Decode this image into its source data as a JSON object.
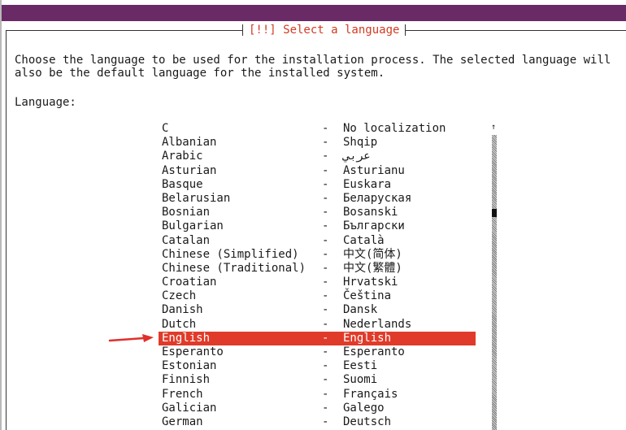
{
  "dialog": {
    "title": "[!!] Select a language",
    "intro_line1": "Choose the language to be used for the installation process. The selected language will",
    "intro_line2": "also be the default language for the installed system.",
    "list_label": "Language:"
  },
  "languages": [
    {
      "name": "C",
      "dash": "-",
      "native": "No localization"
    },
    {
      "name": "Albanian",
      "dash": "-",
      "native": "Shqip"
    },
    {
      "name": "Arabic",
      "dash": "-",
      "native": "عربي"
    },
    {
      "name": "Asturian",
      "dash": "-",
      "native": "Asturianu"
    },
    {
      "name": "Basque",
      "dash": "-",
      "native": "Euskara"
    },
    {
      "name": "Belarusian",
      "dash": "-",
      "native": "Беларуская"
    },
    {
      "name": "Bosnian",
      "dash": "-",
      "native": "Bosanski"
    },
    {
      "name": "Bulgarian",
      "dash": "-",
      "native": "Български"
    },
    {
      "name": "Catalan",
      "dash": "-",
      "native": "Català"
    },
    {
      "name": "Chinese (Simplified)",
      "dash": "-",
      "native": "中文(简体)"
    },
    {
      "name": "Chinese (Traditional)",
      "dash": "-",
      "native": "中文(繁體)"
    },
    {
      "name": "Croatian",
      "dash": "-",
      "native": "Hrvatski"
    },
    {
      "name": "Czech",
      "dash": "-",
      "native": "Čeština"
    },
    {
      "name": "Danish",
      "dash": "-",
      "native": "Dansk"
    },
    {
      "name": "Dutch",
      "dash": "-",
      "native": "Nederlands"
    },
    {
      "name": "English",
      "dash": "-",
      "native": "English",
      "selected": true
    },
    {
      "name": "Esperanto",
      "dash": "-",
      "native": "Esperanto"
    },
    {
      "name": "Estonian",
      "dash": "-",
      "native": "Eesti"
    },
    {
      "name": "Finnish",
      "dash": "-",
      "native": "Suomi"
    },
    {
      "name": "French",
      "dash": "-",
      "native": "Français"
    },
    {
      "name": "Galician",
      "dash": "-",
      "native": "Galego"
    },
    {
      "name": "German",
      "dash": "-",
      "native": "Deutsch"
    }
  ],
  "scrollbar": {
    "up_arrow": "↑",
    "thumb_icon": "scroll-thumb"
  },
  "colors": {
    "topbar": "#6a2a66",
    "title_text": "#d23a22",
    "selection": "#e03b2a",
    "annotation_arrow": "#e0302a"
  }
}
